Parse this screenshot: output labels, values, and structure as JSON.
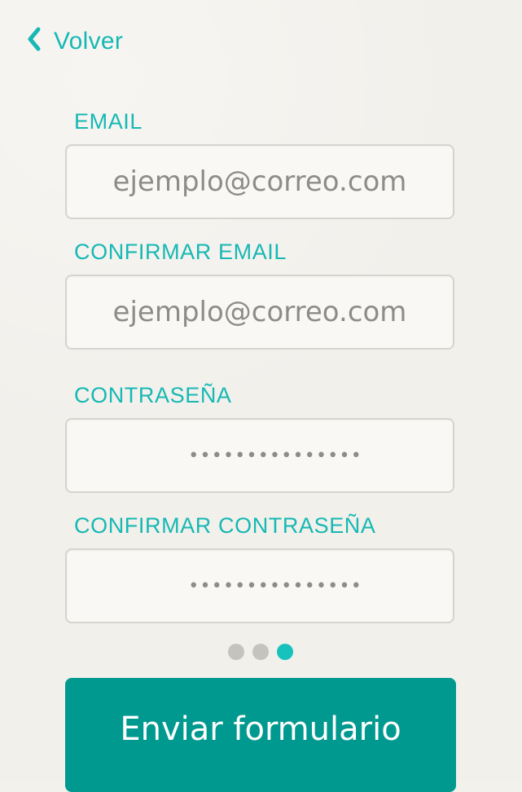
{
  "nav": {
    "back_label": "Volver",
    "back_icon": "chevron-left-icon"
  },
  "form": {
    "fields": [
      {
        "label": "EMAIL",
        "placeholder": "ejemplo@correo.com",
        "value": ""
      },
      {
        "label": "CONFIRMAR EMAIL",
        "placeholder": "ejemplo@correo.com",
        "value": ""
      },
      {
        "label": "CONTRASEÑA",
        "placeholder": "",
        "value": "•••••••••••••••"
      },
      {
        "label": "CONFIRMAR CONTRASEÑA",
        "placeholder": "",
        "value": "•••••••••••••••"
      }
    ],
    "submit_label": "Enviar formulario"
  },
  "pagination": {
    "total": 3,
    "current": 3
  },
  "colors": {
    "accent": "#17b8b4",
    "button": "#009990",
    "background": "#f2f0eb",
    "dot_inactive": "#c4c3c0",
    "dot_active": "#17c2bd"
  }
}
